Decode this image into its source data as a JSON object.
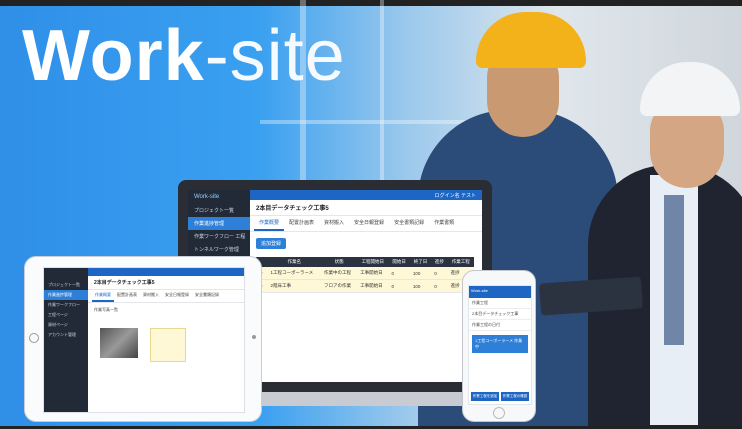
{
  "hero": {
    "title_bold": "Work",
    "title_light": "-site",
    "accent_color": "#2f8fe8"
  },
  "laptop": {
    "sidebar_logo": "Work-site",
    "sidebar_items": [
      "プロジェクト一覧",
      "作業進捗管理",
      "作業ワークフロー 工程",
      "トンネルワーク管理"
    ],
    "header_text": "ログイン名 テスト",
    "page_title": "2本目データチェック工事5",
    "tabs": [
      "作業概要",
      "配置計画表",
      "資材搬入",
      "安全日報登録",
      "安全書類記録",
      "作業書類"
    ],
    "add_button": "追加登録",
    "table_headers": [
      "",
      "作業名",
      "状態",
      "工程開始日",
      "開始日",
      "終了日",
      "進捗",
      "作業工程"
    ],
    "table_rows": [
      [
        "▼",
        "1工程コーポーラーメ",
        "作業中の工程",
        "工事開始日",
        "0",
        "100",
        "0",
        "進捗"
      ],
      [
        "▼",
        "2階床工事",
        "フロアの作業",
        "工事開始日",
        "0",
        "100",
        "0",
        "進捗"
      ]
    ]
  },
  "tablet": {
    "page_title": "2本目データチェック工事5",
    "sidebar_items": [
      "プロジェクト一覧",
      "作業進捗管理",
      "作業ワークフロー",
      "工程ページ",
      "資材ページ",
      "アカウント管理"
    ],
    "tabs": [
      "作業概要",
      "配置計画表",
      "資材搬入",
      "安全日報登録",
      "安全書類記録"
    ],
    "section_label": "作業写真一覧"
  },
  "phone": {
    "header": "Work-site",
    "rows": [
      "作業工程",
      "2本目データチェック工事",
      "作業工程の日付"
    ],
    "card": "1工程コーポーラーメ 作業中",
    "buttons": [
      "作業工程を追加",
      "作業工程の確認"
    ]
  }
}
